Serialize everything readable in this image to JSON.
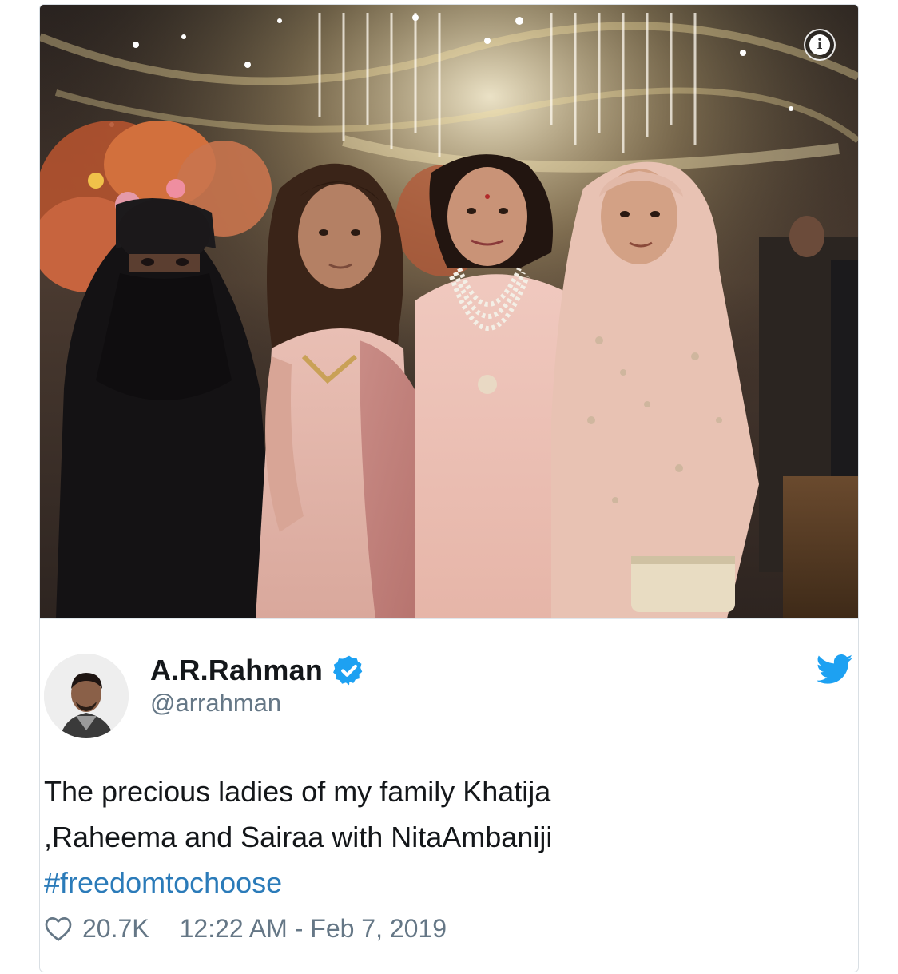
{
  "tweet": {
    "author": {
      "name": "A.R.Rahman",
      "handle": "@arrahman",
      "verified": true
    },
    "text_lines": [
      "The precious ladies of my family Khatija",
      ",Raheema and Sairaa with NitaAmbaniji"
    ],
    "hashtag": "#freedomtochoose",
    "likes": "20.7K",
    "timestamp": "12:22 AM - Feb 7, 2019",
    "info_icon_glyph": "i"
  },
  "icons": {
    "info": "info-icon",
    "verified": "verified-badge-icon",
    "brand": "twitter-bird-icon",
    "like": "heart-icon"
  },
  "colors": {
    "text": "#14171a",
    "secondary": "#657786",
    "link": "#2b7bb9",
    "verified": "#1da1f2",
    "brand": "#1da1f2",
    "border": "#d9dfe4"
  }
}
